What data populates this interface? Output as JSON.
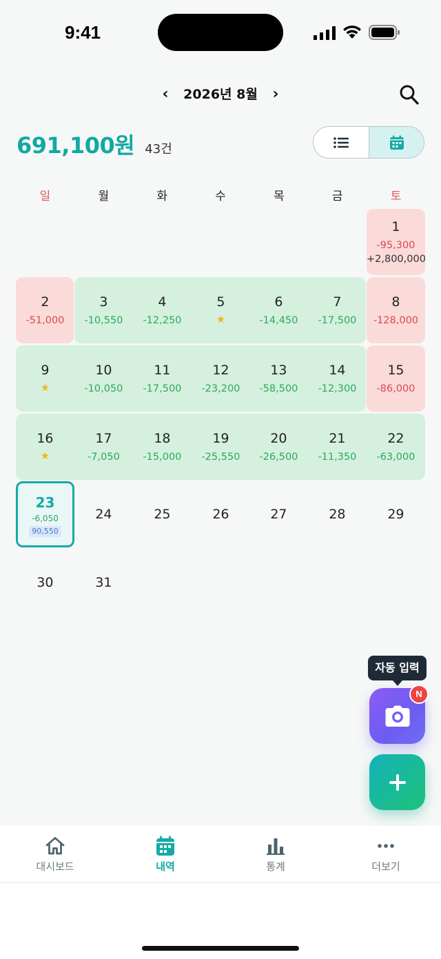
{
  "status_bar": {
    "time": "9:41"
  },
  "header": {
    "prev_label": "‹",
    "month_title": "2026년 8월",
    "next_label": "›"
  },
  "summary": {
    "total": "691,100원",
    "count": "43건"
  },
  "view_toggle": {
    "options": [
      "list-icon",
      "calendar-icon"
    ],
    "selected": "calendar"
  },
  "weekdays": [
    "일",
    "월",
    "화",
    "수",
    "목",
    "금",
    "토"
  ],
  "calendar": {
    "days": [
      {
        "day": "1",
        "amount": "-95,300",
        "amount2": "+2,800,000"
      },
      {
        "day": "2",
        "amount": "-51,000"
      },
      {
        "day": "3",
        "amount": "-10,550"
      },
      {
        "day": "4",
        "amount": "-12,250"
      },
      {
        "day": "5",
        "star": "★"
      },
      {
        "day": "6",
        "amount": "-14,450"
      },
      {
        "day": "7",
        "amount": "-17,500"
      },
      {
        "day": "8",
        "amount": "-128,000"
      },
      {
        "day": "9",
        "star": "★"
      },
      {
        "day": "10",
        "amount": "-10,050"
      },
      {
        "day": "11",
        "amount": "-17,500"
      },
      {
        "day": "12",
        "amount": "-23,200"
      },
      {
        "day": "13",
        "amount": "-58,500"
      },
      {
        "day": "14",
        "amount": "-12,300"
      },
      {
        "day": "15",
        "amount": "-86,000"
      },
      {
        "day": "16",
        "star": "★"
      },
      {
        "day": "17",
        "amount": "-7,050"
      },
      {
        "day": "18",
        "amount": "-15,000"
      },
      {
        "day": "19",
        "amount": "-25,550"
      },
      {
        "day": "20",
        "amount": "-26,500"
      },
      {
        "day": "21",
        "amount": "-11,350"
      },
      {
        "day": "22",
        "amount": "-63,000"
      },
      {
        "day": "23",
        "amount": "-6,050",
        "balance": "90,550"
      },
      {
        "day": "24"
      },
      {
        "day": "25"
      },
      {
        "day": "26"
      },
      {
        "day": "27"
      },
      {
        "day": "28"
      },
      {
        "day": "29"
      },
      {
        "day": "30"
      },
      {
        "day": "31"
      }
    ],
    "colors": {
      "expense_red": "#d94a4c",
      "expense_green": "#2aa95c",
      "accent": "#14aaa6",
      "band_green": "#d5f0de",
      "band_red": "#fbdada"
    }
  },
  "fab": {
    "tooltip": "자동 입력",
    "camera_icon": "camera-icon",
    "badge": "N",
    "add_icon": "plus-icon"
  },
  "tabbar": {
    "items": [
      {
        "label": "대시보드",
        "icon": "home-icon"
      },
      {
        "label": "내역",
        "icon": "calendar-icon"
      },
      {
        "label": "통계",
        "icon": "bar-chart-icon"
      },
      {
        "label": "더보기",
        "icon": "more-icon"
      }
    ],
    "active": "내역"
  }
}
